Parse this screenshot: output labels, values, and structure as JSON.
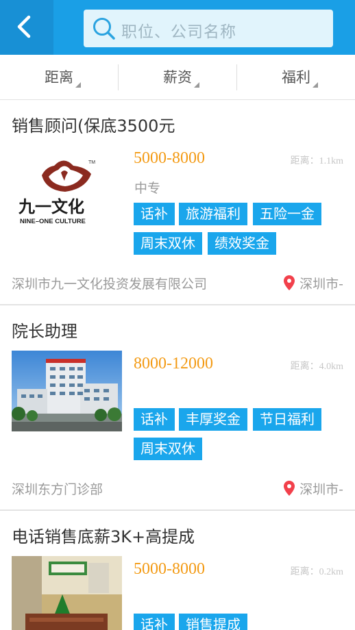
{
  "header": {
    "search_placeholder": "职位、公司名称"
  },
  "filters": [
    {
      "label": "距离"
    },
    {
      "label": "薪资"
    },
    {
      "label": "福利"
    }
  ],
  "jobs": [
    {
      "title": "销售顾问(保底3500元",
      "salary": "5000-8000",
      "distance": "距离：1.1km",
      "education": "中专",
      "tags": [
        "话补",
        "旅游福利",
        "五险一金",
        "周末双休",
        "绩效奖金"
      ],
      "company": "深圳市九一文化投资发展有限公司",
      "location": "深圳市-",
      "logo": {
        "brand": "九一文化",
        "sub": "NINE-ONE CULTURE",
        "tm": "TM"
      }
    },
    {
      "title": "院长助理",
      "salary": "8000-12000",
      "distance": "距离：4.0km",
      "education": "",
      "tags": [
        "话补",
        "丰厚奖金",
        "节日福利",
        "周末双休"
      ],
      "company": "深圳东方门诊部",
      "location": "深圳市-"
    },
    {
      "title": "电话销售底薪3K+高提成",
      "salary": "5000-8000",
      "distance": "距离：0.2km",
      "education": "",
      "tags": [
        "话补",
        "销售提成"
      ],
      "company": "",
      "location": ""
    }
  ],
  "colors": {
    "header_blue": "#1a9fe6",
    "tag_blue": "#1aa6ec",
    "salary_orange": "#f39a13",
    "location_pin_red": "#f2404b"
  }
}
